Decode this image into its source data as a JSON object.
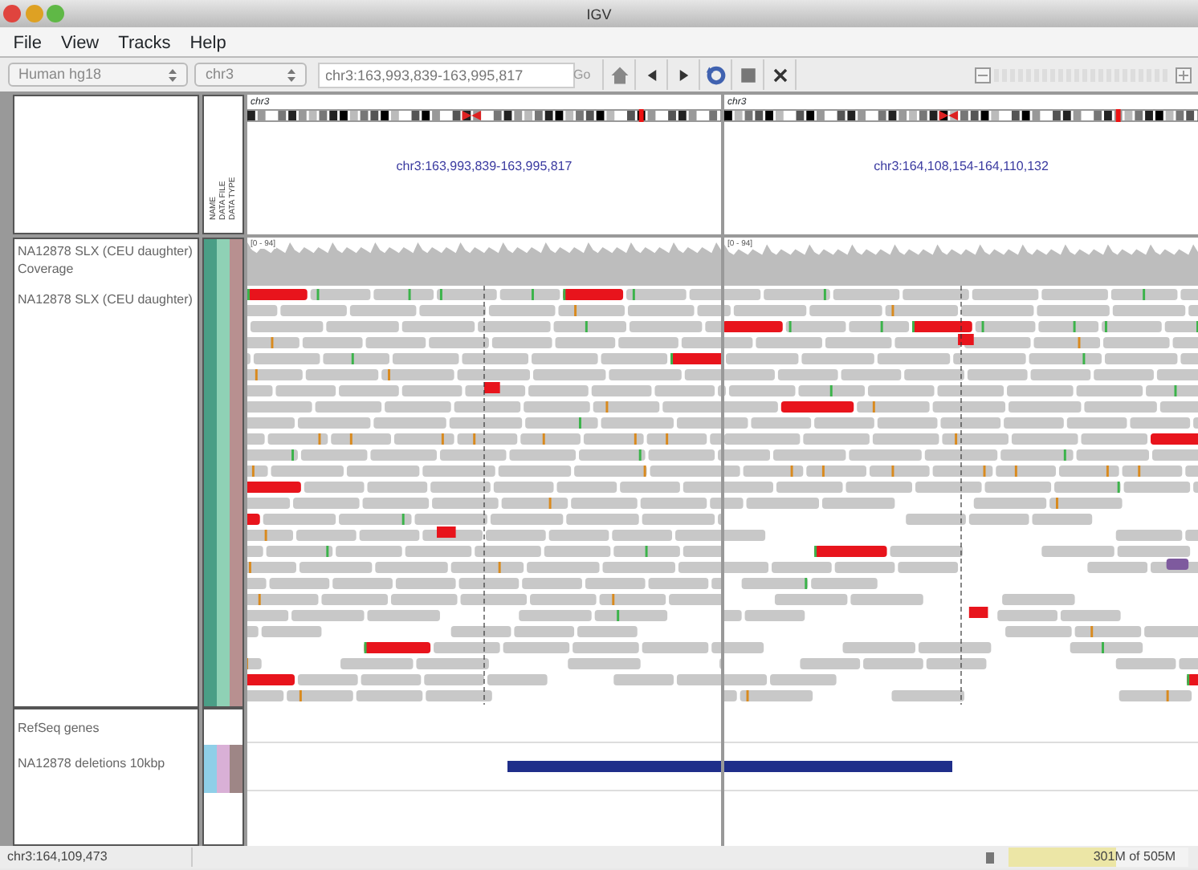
{
  "window": {
    "title": "IGV"
  },
  "menu": [
    "File",
    "View",
    "Tracks",
    "Help"
  ],
  "toolbar": {
    "genome": "Human hg18",
    "chromosome": "chr3",
    "locus": "chr3:163,993,839-163,995,817",
    "go": "Go"
  },
  "attribute_headers": [
    "NAME",
    "DATA FILE",
    "DATA TYPE"
  ],
  "panes": [
    {
      "chromosome": "chr3",
      "locus": "chr3:163,993,839-163,995,817",
      "coverage_range": "[0 - 94]"
    },
    {
      "chromosome": "chr3",
      "locus": "chr3:164,108,154-164,110,132",
      "coverage_range": "[0 - 94]"
    }
  ],
  "data_tracks": [
    {
      "kind": "coverage",
      "name": "NA12878 SLX (CEU daughter) Coverage",
      "attributes": [
        {
          "color": "#4a9e86"
        },
        {
          "color": "#8fd1b5"
        },
        {
          "color": "#b89090"
        }
      ]
    },
    {
      "kind": "alignment",
      "name": "NA12878 SLX (CEU daughter)",
      "attributes": [
        {
          "color": "#4a9e86"
        },
        {
          "color": "#8fd1b5"
        },
        {
          "color": "#b89090"
        }
      ]
    }
  ],
  "feature_tracks": [
    {
      "name": "RefSeq genes"
    },
    {
      "name": "NA12878 deletions 10kbp",
      "attributes": [
        {
          "color": "#8fcfe8"
        },
        {
          "color": "#d9b0d6"
        },
        {
          "color": "#9e8686"
        }
      ]
    }
  ],
  "status_bar": {
    "position": "chr3:164,109,473",
    "memory": {
      "text": "301M of 505M",
      "level": 0.6
    }
  }
}
